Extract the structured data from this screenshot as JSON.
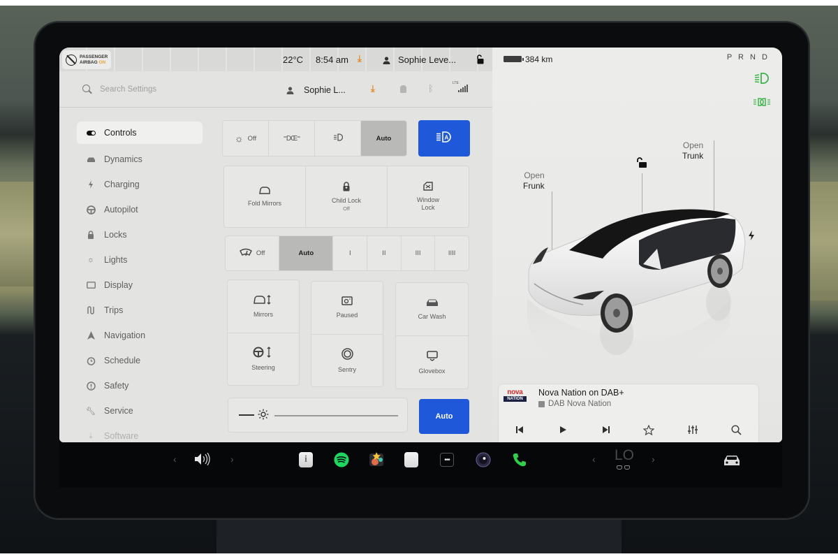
{
  "status_bar": {
    "airbag_line1": "PASSENGER",
    "airbag_line2": "AIRBAG",
    "airbag_state": "ON",
    "temperature": "22°C",
    "time": "8:54 am",
    "user": "Sophie Leve...",
    "download_icon": "download-icon",
    "lock_icon": "unlocked-padlock-icon"
  },
  "settings_header": {
    "search_placeholder": "Search Settings",
    "search_value": "",
    "user": "Sophie L...",
    "network_label": "LTE"
  },
  "sidebar": {
    "items": [
      {
        "label": "Controls",
        "icon": "toggle-icon",
        "active": true
      },
      {
        "label": "Dynamics",
        "icon": "car-icon"
      },
      {
        "label": "Charging",
        "icon": "bolt-icon"
      },
      {
        "label": "Autopilot",
        "icon": "steering-wheel-icon"
      },
      {
        "label": "Locks",
        "icon": "lock-icon"
      },
      {
        "label": "Lights",
        "icon": "sun-icon"
      },
      {
        "label": "Display",
        "icon": "display-icon"
      },
      {
        "label": "Trips",
        "icon": "trips-icon"
      },
      {
        "label": "Navigation",
        "icon": "navigation-arrow-icon"
      },
      {
        "label": "Schedule",
        "icon": "alarm-clock-icon"
      },
      {
        "label": "Safety",
        "icon": "alert-circle-icon"
      },
      {
        "label": "Service",
        "icon": "wrench-icon"
      },
      {
        "label": "Software",
        "icon": "download-icon"
      }
    ]
  },
  "controls": {
    "lights": {
      "options": [
        "Off",
        "",
        "",
        "Auto"
      ],
      "selected": "Auto",
      "auto_high_beam_active": true
    },
    "tiles_row1": [
      {
        "label": "Fold Mirrors",
        "sub": ""
      },
      {
        "label": "Child Lock",
        "sub": "Off"
      },
      {
        "label": "Window",
        "sub": "Lock"
      }
    ],
    "wipers": {
      "options": [
        "Off",
        "Auto",
        "I",
        "II",
        "III",
        "IIII"
      ],
      "selected": "Auto"
    },
    "tiles_grid": [
      {
        "label": "Mirrors"
      },
      {
        "label": "Steering"
      },
      {
        "label": "Paused"
      },
      {
        "label": "Sentry"
      },
      {
        "label": "Car Wash"
      },
      {
        "label": "Glovebox"
      }
    ],
    "brightness": {
      "auto_label": "Auto",
      "level": 0.05
    }
  },
  "vehicle": {
    "range": "384 km",
    "battery_level": 0.95,
    "gear_letters": "P R N D",
    "frunk_top": "Open",
    "frunk_bottom": "Frunk",
    "trunk_top": "Open",
    "trunk_bottom": "Trunk",
    "indicator_color": "#3bb54a"
  },
  "media": {
    "logo_top": "nova",
    "logo_bottom": "NATION",
    "title": "Nova Nation on DAB+",
    "subtitle": "DAB Nova Nation",
    "controls": [
      "previous",
      "play",
      "next",
      "favorite",
      "equalizer",
      "search"
    ]
  },
  "dock": {
    "temperature": "LO",
    "apps": [
      "manual-app",
      "spotify-app",
      "toybox-app",
      "calendar-app",
      "more-apps",
      "camera-app",
      "phone-app"
    ]
  },
  "colors": {
    "accent_blue": "#1f58d8",
    "download_orange": "#e38a2c",
    "spotify_green": "#1ed760",
    "phone_green": "#2fcf4b"
  }
}
